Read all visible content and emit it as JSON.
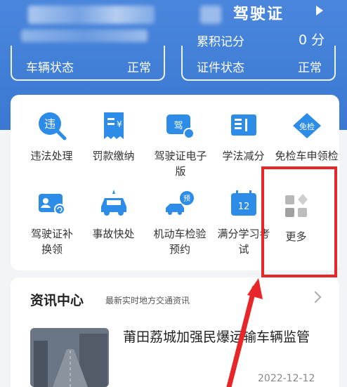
{
  "license": {
    "title": "驾驶证",
    "points_label": "累积记分",
    "points_value": "0 分"
  },
  "status": {
    "vehicle_label": "车辆状态",
    "vehicle_value": "正常",
    "cert_label": "证件状态",
    "cert_value": "正常"
  },
  "services": [
    {
      "label": "违法处理",
      "icon": "violation-search-icon"
    },
    {
      "label": "罚款缴纳",
      "icon": "fine-receipt-icon"
    },
    {
      "label": "驾驶证电子版",
      "icon": "e-license-icon"
    },
    {
      "label": "学法减分",
      "icon": "study-book-icon"
    },
    {
      "label": "免检车申领检验标志",
      "icon": "exempt-badge-icon"
    },
    {
      "label": "驾驶证补换领",
      "icon": "license-reissue-icon"
    },
    {
      "label": "事故快处",
      "icon": "accident-car-icon"
    },
    {
      "label": "机动车检验预约",
      "icon": "inspection-booking-icon"
    },
    {
      "label": "满分学习考试",
      "icon": "calendar-12-icon"
    },
    {
      "label": "更多",
      "icon": "more-grid-icon"
    }
  ],
  "news": {
    "title": "资讯中心",
    "subtitle": "最新实时地方交通资讯",
    "headline": "莆田荔城加强民爆运输车辆监管",
    "date": "2022-12-12"
  },
  "colors": {
    "hero": "#3a78d2",
    "icon_blue": "#2d8ce8",
    "highlight": "#e8262a"
  }
}
